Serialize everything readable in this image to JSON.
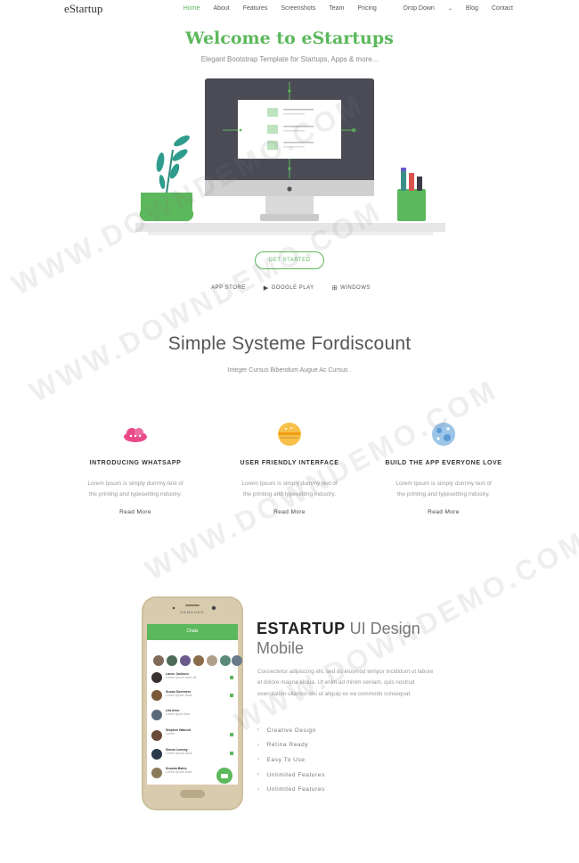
{
  "nav": {
    "logo": "eStartup",
    "items": [
      {
        "label": "Home",
        "active": true
      },
      {
        "label": "About"
      },
      {
        "label": "Features"
      },
      {
        "label": "Screenshots"
      },
      {
        "label": "Team"
      },
      {
        "label": "Pricing"
      },
      {
        "label": "Drop Down",
        "dropdown": true
      },
      {
        "label": "Blog"
      },
      {
        "label": "Contact"
      }
    ]
  },
  "hero": {
    "title": "Welcome to eStartups",
    "subtitle": "Elegant Bootstrap Template for Startups, Apps & more...",
    "cta": "GET STARTED",
    "stores": [
      {
        "icon": "apple-icon",
        "label": "APP STORE"
      },
      {
        "icon": "play-icon",
        "label": "GOOGLE PLAY"
      },
      {
        "icon": "windows-icon",
        "label": "WINDOWS"
      }
    ]
  },
  "section2": {
    "title": "Simple Systeme Fordiscount",
    "subtitle": "Integer Cursus Bibendum Augue Ac Cursus .",
    "features": [
      {
        "icon": "cloud-icon",
        "title": "INTRODUCING WHATSAPP",
        "text": "Lorem Ipsum is simply dummy text of the printing and typesetting industry.",
        "more": "Read More"
      },
      {
        "icon": "burger-icon",
        "title": "USER FRIENDLY INTERFACE",
        "text": "Lorem Ipsum is simply dummy text of the printing and typesetting industry.",
        "more": "Read More"
      },
      {
        "icon": "planet-icon",
        "title": "BUILD THE APP EVERYONE LOVE",
        "text": "Lorem Ipsum is simply dummy text of the printing and typesetting industry.",
        "more": "Read More"
      }
    ]
  },
  "section3": {
    "title_bold": "ESTARTUP",
    "title_light": " UI Design",
    "title_line2": "Mobile",
    "text": "Consectetur adipiscing elit, sed do eiusmod tempor incididunt ut labore et dolore magna aliqua. Ut enim ad minim veniam, quis nostrud exercitation ullamco nisi ut aliquip ex ea commodo consequat.",
    "list": [
      "Creative Design",
      "Retina Ready",
      "Easy To Use",
      "Unlimited Features",
      "Unlimited Features"
    ]
  },
  "phone": {
    "brand": "SAMSUNG",
    "header": "Chats",
    "chats": [
      {
        "name": "Lance Jackson",
        "msg": "Lorem ipsum dolor sit"
      },
      {
        "name": "Susan Sommers",
        "msg": "Lorem ipsum dolor"
      },
      {
        "name": "Lila Arno",
        "msg": "Lorem good idea"
      },
      {
        "name": "Stephen Walcott",
        "msg": "Lorem"
      },
      {
        "name": "Simon Lummy",
        "msg": "Lorem ipsum dolor"
      },
      {
        "name": "Susana Bains",
        "msg": "Lorem ipsum dolor"
      }
    ]
  },
  "watermark": "WWW.DOWNDEMO.COM",
  "colors": {
    "accent": "#5cb85c",
    "dark": "#4a4b55"
  }
}
